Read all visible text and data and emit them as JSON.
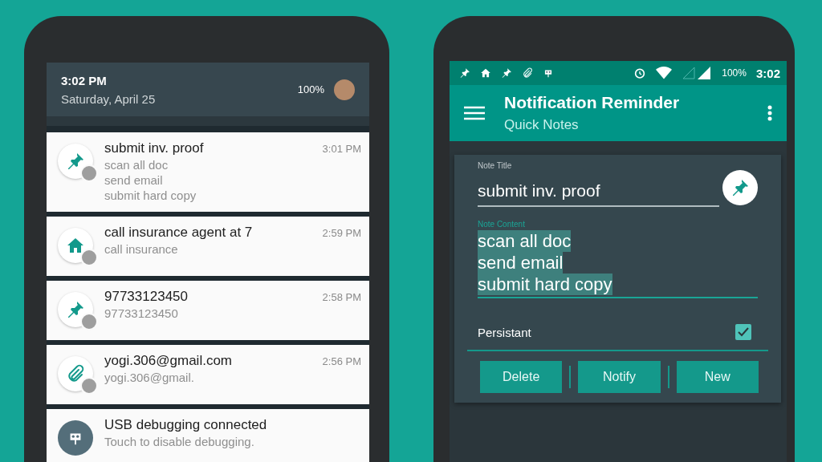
{
  "left_phone": {
    "header": {
      "time": "3:02 PM",
      "date": "Saturday, April 25",
      "battery": "100%"
    },
    "notifications": [
      {
        "kind": "pin",
        "title": "submit inv. proof",
        "time": "3:01 PM",
        "lines": [
          "scan all doc",
          "send email",
          "submit hard copy"
        ]
      },
      {
        "kind": "home",
        "title": "call insurance agent at 7",
        "time": "2:59 PM",
        "lines": [
          "call insurance"
        ]
      },
      {
        "kind": "pin",
        "title": "97733123450",
        "time": "2:58 PM",
        "lines": [
          "97733123450"
        ]
      },
      {
        "kind": "clip",
        "title": "yogi.306@gmail.com",
        "time": "2:56 PM",
        "lines": [
          "yogi.306@gmail."
        ]
      },
      {
        "kind": "system",
        "title": "USB debugging connected",
        "lines": [
          "Touch to disable debugging."
        ]
      }
    ]
  },
  "right_phone": {
    "status_bar": {
      "battery": "100%",
      "time": "3:02"
    },
    "toolbar": {
      "title": "Notification Reminder",
      "subtitle": "Quick Notes"
    },
    "note": {
      "title_label": "Note Title",
      "title_value": "submit inv. proof",
      "content_label": "Note Content",
      "content_lines": [
        "scan all doc",
        "send email",
        "submit hard copy"
      ],
      "content_selected": true,
      "persistent_label": "Persistant",
      "persistent_checked": true,
      "buttons": [
        "Delete",
        "Notify",
        "New"
      ]
    }
  }
}
